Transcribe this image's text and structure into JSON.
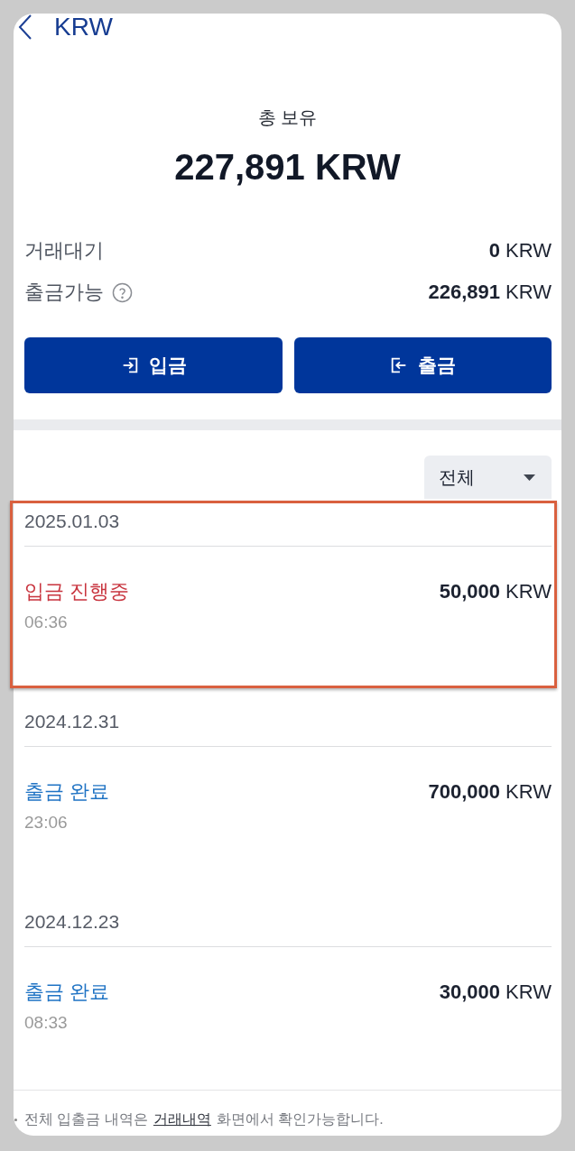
{
  "header": {
    "title": "KRW"
  },
  "summary": {
    "label": "총 보유",
    "total": "227,891 KRW"
  },
  "balances": [
    {
      "label": "거래대기",
      "value": "**0** KRW",
      "help_icon": false
    },
    {
      "label": "출금가능",
      "value": "**226,891** KRW",
      "help_icon": true
    }
  ],
  "actions": [
    {
      "kind": "deposit",
      "label": "입금"
    },
    {
      "kind": "withdraw",
      "label": "출금"
    }
  ],
  "filter": {
    "value": "전체"
  },
  "transactions": [
    {
      "date": "2025.01.03",
      "status": "입금 진행중",
      "color": "#c8343e",
      "amount": "**50,000** KRW",
      "time": "06:36",
      "highlighted": true
    },
    {
      "date": "2024.12.31",
      "status": "출금 완료",
      "color": "#1f73c4",
      "amount": "**700,000** KRW",
      "time": "23:06",
      "highlighted": false
    },
    {
      "date": "2024.12.23",
      "status": "출금 완료",
      "color": "#1f73c4",
      "amount": "**30,000** KRW",
      "time": "08:33",
      "highlighted": false
    }
  ],
  "footnote": {
    "text_before": "전체 입출금 내역은",
    "link": "거래내역",
    "text_after": "화면에서 확인가능합니다."
  }
}
